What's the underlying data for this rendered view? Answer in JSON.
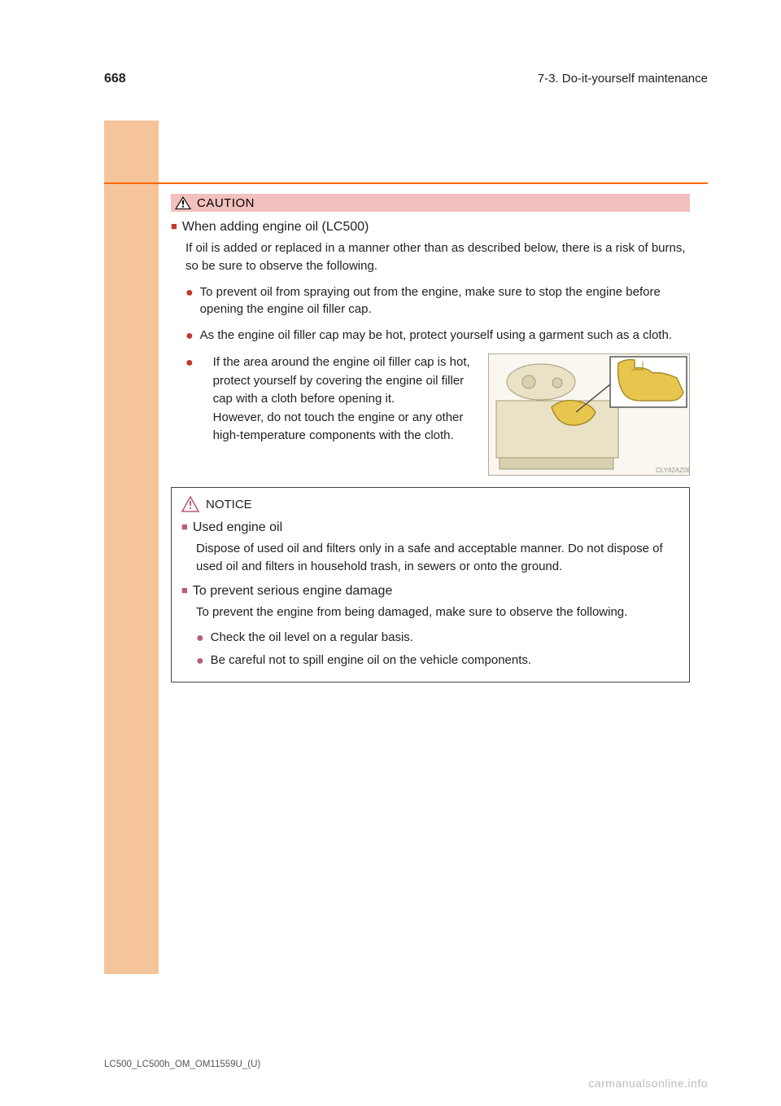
{
  "page_number": "668",
  "section": "7-3. Do-it-yourself maintenance",
  "chapter_ref": "LC500_LC500h_OM_OM11559U_(U)",
  "caution_label": "CAUTION",
  "topic1": {
    "title": "When adding engine oil (LC500)",
    "intro": "If oil is added or replaced in a manner other than as described below, there is a risk of burns, so be sure to observe the following.",
    "bullets": [
      "To prevent oil from spraying out from the engine, make sure to stop the engine before opening the engine oil filler cap.",
      "As the engine oil filler cap may be hot, protect yourself using a garment such as a cloth."
    ],
    "wrap_bullet_lead": "",
    "wrap_bullet": "If the area around the engine oil filler cap is hot, protect yourself by covering the engine oil filler cap with a cloth before opening it.",
    "wrap_bullet_cont": "However, do not touch the engine or any other high-temperature components with the cloth."
  },
  "notice_label": "NOTICE",
  "notice": {
    "item1_title": "Used engine oil",
    "item1_body": "Dispose of used oil and filters only in a safe and acceptable manner. Do not dispose of used oil and filters in household trash, in sewers or onto the ground.",
    "item2_title": "To prevent serious engine damage",
    "item2_intro": "To prevent the engine from being damaged, make sure to observe the following.",
    "item2_bullets": [
      "Check the oil level on a regular basis.",
      "Be careful not to spill engine oil on the vehicle components."
    ]
  },
  "watermark": "carmanualsonline.info",
  "footnote_id": "LC500_LC500h_OM_OM11559U_(U)"
}
